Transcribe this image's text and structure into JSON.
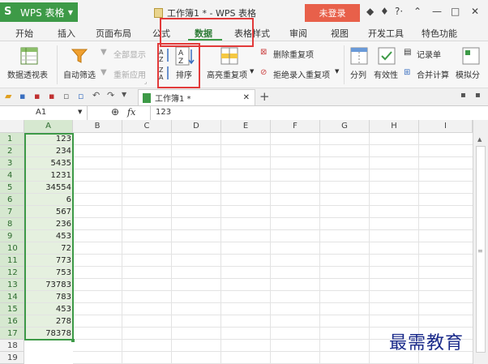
{
  "titlebar": {
    "app_name": "WPS 表格",
    "doc_title": "工作簿1 * - WPS 表格",
    "login": "未登录",
    "icons": [
      "skin-icon",
      "shirt-icon",
      "help-icon",
      "minimize-ribbon-icon",
      "minimize-icon",
      "maximize-icon",
      "close-icon"
    ]
  },
  "tabs": [
    "开始",
    "插入",
    "页面布局",
    "公式",
    "数据",
    "表格样式",
    "审阅",
    "视图",
    "开发工具",
    "特色功能"
  ],
  "active_tab": "数据",
  "ribbon": {
    "pivot": "数据透视表",
    "autofilter": "自动筛选",
    "show_all": "全部显示",
    "reapply": "重新应用",
    "sort": "排序",
    "highlight_dup": "高亮重复项",
    "remove_dup": "删除重复项",
    "reject_dup": "拒绝录入重复项",
    "split": "分列",
    "validity": "有效性",
    "record_form": "记录单",
    "consolidate": "合并计算",
    "simulate": "模拟分"
  },
  "sheet_tab": "工作簿1 *",
  "formula_bar": {
    "name_box": "A1",
    "fx": "fx",
    "value": "123"
  },
  "columns": [
    "A",
    "B",
    "C",
    "D",
    "E",
    "F",
    "G",
    "H",
    "I"
  ],
  "rows": [
    {
      "n": "1",
      "a": "123"
    },
    {
      "n": "2",
      "a": "234"
    },
    {
      "n": "3",
      "a": "5435"
    },
    {
      "n": "4",
      "a": "1231"
    },
    {
      "n": "5",
      "a": "34554"
    },
    {
      "n": "6",
      "a": "6"
    },
    {
      "n": "7",
      "a": "567"
    },
    {
      "n": "8",
      "a": "236"
    },
    {
      "n": "9",
      "a": "453"
    },
    {
      "n": "10",
      "a": "72"
    },
    {
      "n": "11",
      "a": "773"
    },
    {
      "n": "12",
      "a": "753"
    },
    {
      "n": "13",
      "a": "73783"
    },
    {
      "n": "14",
      "a": "783"
    },
    {
      "n": "15",
      "a": "453"
    },
    {
      "n": "16",
      "a": "278"
    },
    {
      "n": "17",
      "a": "78378"
    },
    {
      "n": "18",
      "a": ""
    },
    {
      "n": "19",
      "a": ""
    }
  ],
  "watermark": "最需教育",
  "colors": {
    "brand_green": "#3d9a47",
    "login_red": "#e8604a",
    "highlight_red": "#e23a3a"
  }
}
